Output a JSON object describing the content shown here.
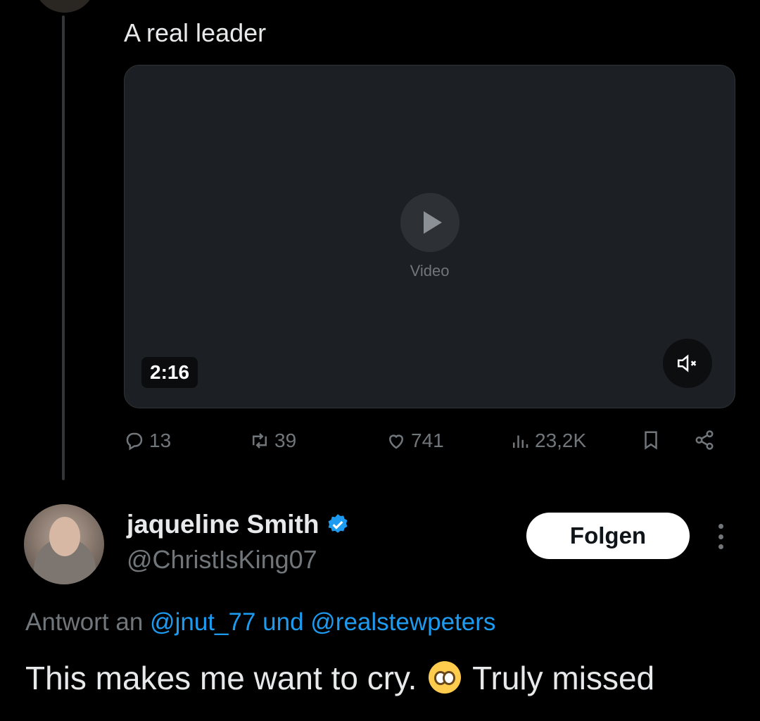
{
  "parent_tweet": {
    "text": "A real leader",
    "media": {
      "duration": "2:16",
      "placeholder_note": "Video"
    },
    "actions": {
      "replies": "13",
      "reposts": "39",
      "likes": "741",
      "views": "23,2K"
    }
  },
  "reply_tweet": {
    "display_name": "jaqueline Smith",
    "handle": "@ChristIsKing07",
    "follow_label": "Folgen",
    "reply_prefix": "Antwort an",
    "reply_mention_1": "@jnut_77",
    "reply_joiner": "und",
    "reply_mention_2": "@realstewpeters",
    "text_before_emoji": "This makes me want to cry.",
    "text_after_emoji": "Truly missed"
  },
  "colors": {
    "background": "#000000",
    "text": "#e7e9ea",
    "muted": "#71767b",
    "accent": "#1d9bf0"
  }
}
